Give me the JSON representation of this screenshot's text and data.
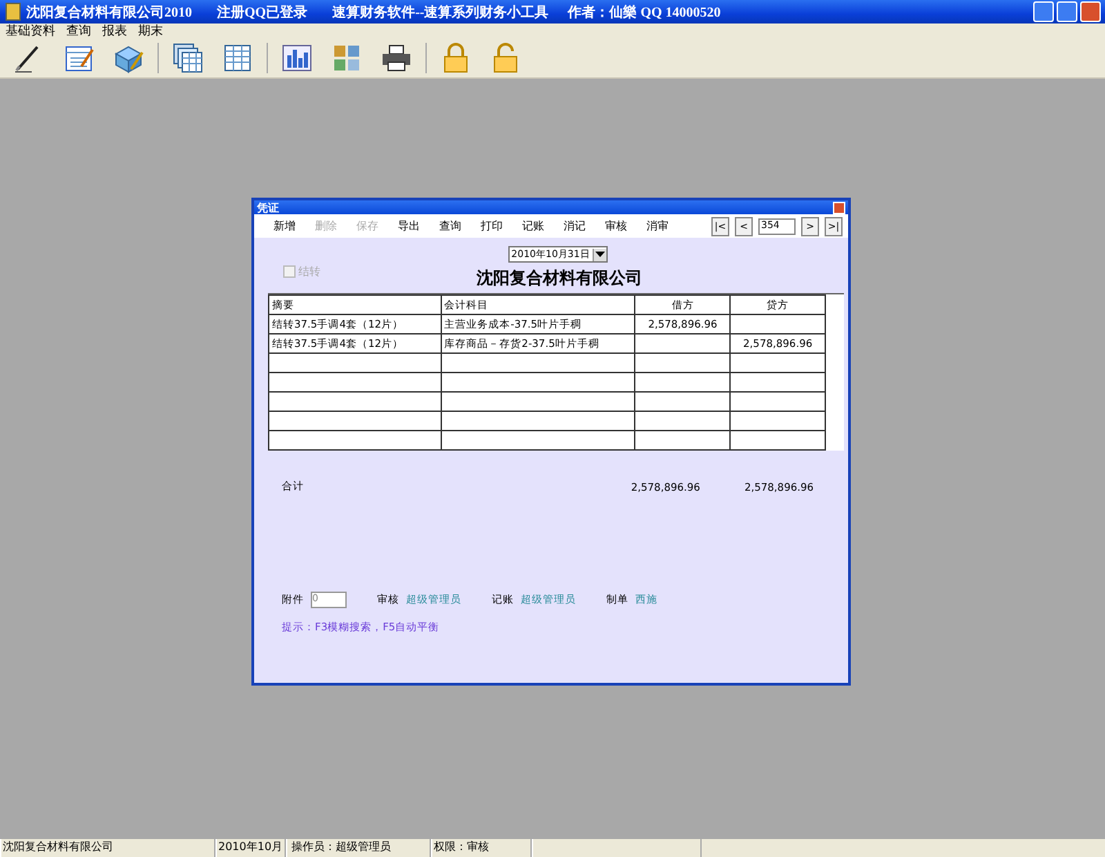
{
  "window": {
    "title": "沈阳复合材料有限公司2010",
    "login": "注册QQ已登录",
    "product": "速算财务软件--速算系列财务小工具",
    "author": "作者：仙樂  QQ  14000520"
  },
  "menu": [
    "基础资料",
    "查询",
    "报表",
    "期末"
  ],
  "voucher": {
    "title": "凭证",
    "toolbar": [
      {
        "label": "新增",
        "disabled": false
      },
      {
        "label": "删除",
        "disabled": true
      },
      {
        "label": "保存",
        "disabled": true
      },
      {
        "label": "导出",
        "disabled": false
      },
      {
        "label": "查询",
        "disabled": false
      },
      {
        "label": "打印",
        "disabled": false
      },
      {
        "label": "记账",
        "disabled": false
      },
      {
        "label": "消记",
        "disabled": false
      },
      {
        "label": "审核",
        "disabled": false
      },
      {
        "label": "消审",
        "disabled": false
      }
    ],
    "nav": {
      "first": "|<",
      "prev": "<",
      "page": "354",
      "next": ">",
      "last": ">|"
    },
    "date": "2010年10月31日",
    "carry_over": {
      "label": "结转",
      "checked": false,
      "disabled": true
    },
    "company": "沈阳复合材料有限公司",
    "columns": [
      "摘要",
      "会计科目",
      "借方",
      "贷方"
    ],
    "rows": [
      [
        "结转37.5手调4套（12片）",
        "主营业务成本-37.5叶片手稠",
        "2,578,896.96",
        null
      ],
      [
        "结转37.5手调4套（12片）",
        "库存商品－存货2-37.5叶片手稠",
        null,
        "2,578,896.96"
      ]
    ],
    "totals": {
      "label": "合计",
      "debit": "2,578,896.96",
      "credit": "2,578,896.96"
    },
    "attachment": {
      "label": "附件",
      "value": "0"
    },
    "signatures": [
      {
        "label": "审核",
        "name": "超级管理员"
      },
      {
        "label": "记账",
        "name": "超级管理员"
      },
      {
        "label": "制单",
        "name": "西施"
      }
    ],
    "hint": "提示：F3模糊搜索，F5自动平衡"
  },
  "status_bar": [
    "沈阳复合材料有限公司",
    "2010年10月",
    "操作员：超级管理员",
    "权限：审核"
  ]
}
